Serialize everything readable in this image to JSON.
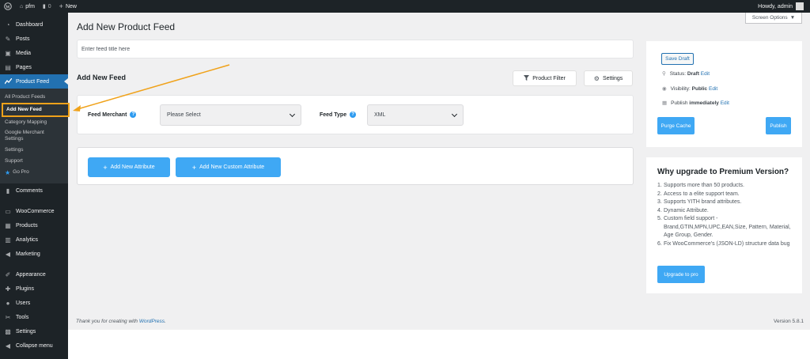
{
  "adminbar": {
    "site_name": "pfm",
    "comments_count": "0",
    "new_label": "New",
    "howdy": "Howdy, admin"
  },
  "sidebar": {
    "items_top": [
      {
        "label": "Dashboard",
        "icon": "dashboard-icon",
        "glyph": "◔"
      },
      {
        "label": "Posts",
        "icon": "pin-icon",
        "glyph": "✎"
      },
      {
        "label": "Media",
        "icon": "media-icon",
        "glyph": "▣"
      },
      {
        "label": "Pages",
        "icon": "pages-icon",
        "glyph": "▤"
      }
    ],
    "product_feed": {
      "label": "Product Feed",
      "icon": "chart-line-icon",
      "glyph": "⟋"
    },
    "submenu": [
      {
        "label": "All Product Feeds"
      },
      {
        "label": "Add New Feed"
      },
      {
        "label": "Category Mapping"
      },
      {
        "label": "Google Merchant Settings"
      },
      {
        "label": "Settings"
      },
      {
        "label": "Support"
      },
      {
        "label": "Go Pro"
      }
    ],
    "items_mid": [
      {
        "label": "Comments",
        "icon": "comments-icon",
        "glyph": "▮"
      }
    ],
    "items_woo": [
      {
        "label": "WooCommerce",
        "icon": "woocommerce-icon",
        "glyph": "▭"
      },
      {
        "label": "Products",
        "icon": "products-icon",
        "glyph": "▦"
      },
      {
        "label": "Analytics",
        "icon": "analytics-icon",
        "glyph": "▥"
      },
      {
        "label": "Marketing",
        "icon": "megaphone-icon",
        "glyph": "◀"
      }
    ],
    "items_bottom": [
      {
        "label": "Appearance",
        "icon": "brush-icon",
        "glyph": "✐"
      },
      {
        "label": "Plugins",
        "icon": "plugin-icon",
        "glyph": "✚"
      },
      {
        "label": "Users",
        "icon": "users-icon",
        "glyph": "●"
      },
      {
        "label": "Tools",
        "icon": "wrench-icon",
        "glyph": "✂"
      },
      {
        "label": "Settings",
        "icon": "settings-icon",
        "glyph": "▩"
      },
      {
        "label": "Collapse menu",
        "icon": "collapse-icon",
        "glyph": "◀"
      }
    ]
  },
  "screen_options": "Screen Options",
  "main": {
    "page_title": "Add New Product Feed",
    "feed_title_placeholder": "Enter feed title here",
    "section_title": "Add New Feed",
    "product_filter_label": "Product Filter",
    "settings_label": "Settings",
    "feed_merchant_label": "Feed Merchant",
    "feed_merchant_value": "Please Select",
    "feed_type_label": "Feed Type",
    "feed_type_value": "XML",
    "add_attribute_label": "Add New Attribute",
    "add_custom_attribute_label": "Add New Custom Attribute"
  },
  "publish": {
    "save_draft": "Save Draft",
    "status_label": "Status:",
    "status_value": "Draft",
    "visibility_label": "Visibility:",
    "visibility_value": "Public",
    "publish_label": "Publish",
    "publish_value": "immediately",
    "edit": "Edit",
    "purge_cache": "Purge Cache",
    "publish_button": "Publish"
  },
  "upgrade": {
    "title": "Why upgrade to Premium Version?",
    "items": [
      "Supports more than 50 products.",
      "Access to a elite support team.",
      "Supports YITH brand attributes.",
      "Dynamic Attribute.",
      "Custom field support - Brand,GTIN,MPN,UPC,EAN,Size, Pattern, Material, Age Group, Gender.",
      "Fix WooCommerce's (JSON-LD) structure data bug"
    ],
    "button": "Upgrade to pro"
  },
  "footer": {
    "thanks_prefix": "Thank you for creating with",
    "wordpress": "WordPress",
    "version": "Version 5.8.1"
  },
  "colors": {
    "accent": "#2271b1",
    "button_blue": "#3fa8f4",
    "annotation_orange": "#f0a21a"
  }
}
